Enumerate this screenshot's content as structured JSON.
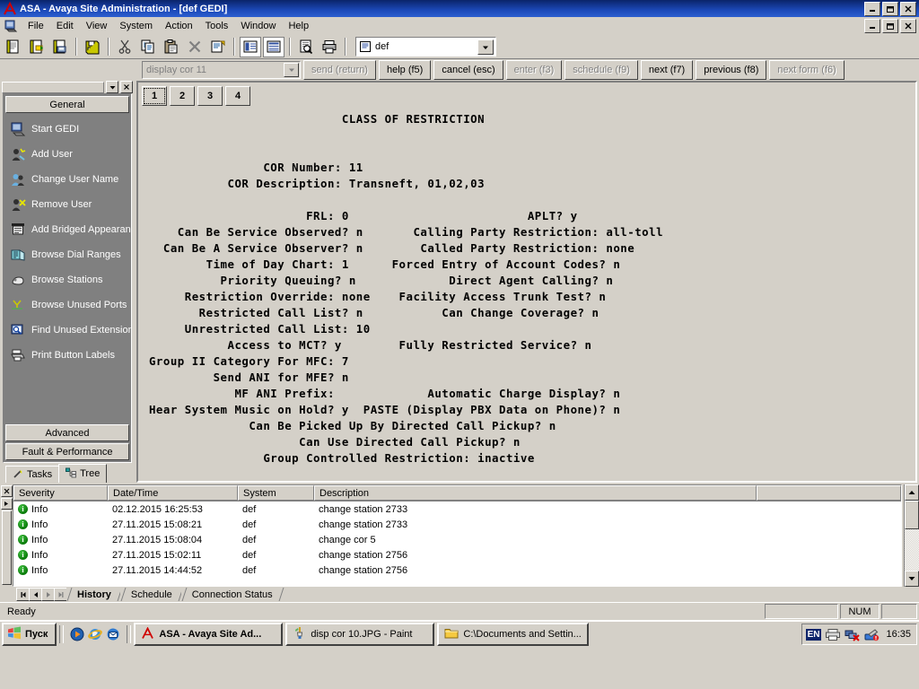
{
  "window": {
    "title": "ASA - Avaya Site Administration - [def GEDI]",
    "logo_icon": "avaya-a-icon",
    "controls": [
      "minimize",
      "restore",
      "close"
    ]
  },
  "menubar": {
    "doc_icon": "gedi-doc-icon",
    "items": [
      "File",
      "Edit",
      "View",
      "System",
      "Action",
      "Tools",
      "Window",
      "Help"
    ],
    "controls": [
      "minimize",
      "restore",
      "close"
    ]
  },
  "toolbar": {
    "buttons": [
      {
        "name": "new-icon"
      },
      {
        "name": "open-icon"
      },
      {
        "name": "save-as-icon"
      },
      {
        "name": "save-all-icon"
      },
      {
        "name": "cut-icon"
      },
      {
        "name": "copy-icon"
      },
      {
        "name": "paste-icon"
      },
      {
        "name": "delete-icon"
      },
      {
        "name": "properties-icon"
      },
      {
        "name": "list-view-icon"
      },
      {
        "name": "details-view-icon"
      },
      {
        "name": "print-preview-icon"
      },
      {
        "name": "print-icon"
      }
    ],
    "system_combo": {
      "icon": "system-icon",
      "value": "def",
      "arrow": "chevron-down-icon"
    }
  },
  "commandbar": {
    "command_input": {
      "value": "display cor 11",
      "arrow": "chevron-down-icon"
    },
    "buttons": [
      {
        "label": "send (return)",
        "disabled": true
      },
      {
        "label": "help (f5)",
        "disabled": false
      },
      {
        "label": "cancel (esc)",
        "disabled": false
      },
      {
        "label": "enter (f3)",
        "disabled": true
      },
      {
        "label": "schedule (f9)",
        "disabled": true
      },
      {
        "label": "next (f7)",
        "disabled": false
      },
      {
        "label": "previous (f8)",
        "disabled": false
      },
      {
        "label": "next form (f6)",
        "disabled": true
      }
    ]
  },
  "sidebar": {
    "collapse_arrow_icon": "chevron-down-icon",
    "close_icon": "close-icon",
    "group_header": "General",
    "items": [
      {
        "label": "Start GEDI",
        "icon": "start-gedi-icon"
      },
      {
        "label": "Add User",
        "icon": "add-user-icon"
      },
      {
        "label": "Change User Name",
        "icon": "change-user-icon"
      },
      {
        "label": "Remove User",
        "icon": "remove-user-icon"
      },
      {
        "label": "Add Bridged Appearan",
        "icon": "bridged-appearance-icon"
      },
      {
        "label": "Browse Dial Ranges",
        "icon": "dial-ranges-icon"
      },
      {
        "label": "Browse Stations",
        "icon": "stations-icon"
      },
      {
        "label": "Browse Unused Ports",
        "icon": "unused-ports-icon"
      },
      {
        "label": "Find Unused Extension",
        "icon": "find-extension-icon"
      },
      {
        "label": "Print Button Labels",
        "icon": "print-labels-icon"
      }
    ],
    "bottom_groups": [
      "Advanced",
      "Fault & Performance"
    ],
    "tabs": [
      {
        "label": "Tasks",
        "icon": "wand-icon",
        "selected": false
      },
      {
        "label": "Tree",
        "icon": "tree-icon",
        "selected": true
      }
    ]
  },
  "form": {
    "page_tabs": [
      "1",
      "2",
      "3",
      "4"
    ],
    "active_page": "1",
    "screen_lines": [
      "                            CLASS OF RESTRICTION",
      "",
      "",
      "                 COR Number: 11",
      "            COR Description: Transneft, 01,02,03",
      "",
      "                       FRL: 0                         APLT? y",
      "     Can Be Service Observed? n       Calling Party Restriction: all-toll",
      "   Can Be A Service Observer? n        Called Party Restriction: none",
      "         Time of Day Chart: 1      Forced Entry of Account Codes? n",
      "           Priority Queuing? n             Direct Agent Calling? n",
      "      Restriction Override: none    Facility Access Trunk Test? n",
      "        Restricted Call List? n           Can Change Coverage? n",
      "      Unrestricted Call List: 10",
      "            Access to MCT? y        Fully Restricted Service? n",
      " Group II Category For MFC: 7",
      "          Send ANI for MFE? n",
      "             MF ANI Prefix:             Automatic Charge Display? n",
      " Hear System Music on Hold? y  PASTE (Display PBX Data on Phone)? n",
      "               Can Be Picked Up By Directed Call Pickup? n",
      "                      Can Use Directed Call Pickup? n",
      "                 Group Controlled Restriction: inactive"
    ],
    "fields": {
      "title": "CLASS OF RESTRICTION",
      "cor_number": {
        "label": "COR Number:",
        "value": "11"
      },
      "cor_description": {
        "label": "COR Description:",
        "value": "Transneft, 01,02,03"
      },
      "frl": {
        "label": "FRL:",
        "value": "0"
      },
      "aplt": {
        "label": "APLT?",
        "value": "y"
      },
      "can_be_service_observed": {
        "label": "Can Be Service Observed?",
        "value": "n"
      },
      "calling_party_restriction": {
        "label": "Calling Party Restriction:",
        "value": "all-toll"
      },
      "can_be_a_service_observer": {
        "label": "Can Be A Service Observer?",
        "value": "n"
      },
      "called_party_restriction": {
        "label": "Called Party Restriction:",
        "value": "none"
      },
      "time_of_day_chart": {
        "label": "Time of Day Chart:",
        "value": "1"
      },
      "forced_entry_of_account_codes": {
        "label": "Forced Entry of Account Codes?",
        "value": "n"
      },
      "priority_queuing": {
        "label": "Priority Queuing?",
        "value": "n"
      },
      "direct_agent_calling": {
        "label": "Direct Agent Calling?",
        "value": "n"
      },
      "restriction_override": {
        "label": "Restriction Override:",
        "value": "none"
      },
      "facility_access_trunk_test": {
        "label": "Facility Access Trunk Test?",
        "value": "n"
      },
      "restricted_call_list": {
        "label": "Restricted Call List?",
        "value": "n"
      },
      "can_change_coverage": {
        "label": "Can Change Coverage?",
        "value": "n"
      },
      "unrestricted_call_list": {
        "label": "Unrestricted Call List:",
        "value": "10"
      },
      "access_to_mct": {
        "label": "Access to MCT?",
        "value": "y"
      },
      "fully_restricted_service": {
        "label": "Fully Restricted Service?",
        "value": "n"
      },
      "group_ii_category_for_mfc": {
        "label": "Group II Category For MFC:",
        "value": "7"
      },
      "send_ani_for_mfe": {
        "label": "Send ANI for MFE?",
        "value": "n"
      },
      "mf_ani_prefix": {
        "label": "MF ANI Prefix:",
        "value": ""
      },
      "automatic_charge_display": {
        "label": "Automatic Charge Display?",
        "value": "n"
      },
      "hear_system_music_on_hold": {
        "label": "Hear System Music on Hold?",
        "value": "y"
      },
      "paste": {
        "label": "PASTE (Display PBX Data on Phone)?",
        "value": "n"
      },
      "can_be_picked_up": {
        "label": "Can Be Picked Up By Directed Call Pickup?",
        "value": "n"
      },
      "can_use_directed_call_pickup": {
        "label": "Can Use Directed Call Pickup?",
        "value": "n"
      },
      "group_controlled_restriction": {
        "label": "Group Controlled Restriction:",
        "value": "inactive"
      }
    }
  },
  "log": {
    "close_icon": "close-icon",
    "expand_icon": "chevron-right-icon",
    "columns": [
      "Severity",
      "Date/Time",
      "System",
      "Description"
    ],
    "rows": [
      {
        "severity": "Info",
        "datetime": "02.12.2015 16:25:53",
        "system": "def",
        "description": "change station 2733"
      },
      {
        "severity": "Info",
        "datetime": "27.11.2015 15:08:21",
        "system": "def",
        "description": "change station 2733"
      },
      {
        "severity": "Info",
        "datetime": "27.11.2015 15:08:04",
        "system": "def",
        "description": "change cor 5"
      },
      {
        "severity": "Info",
        "datetime": "27.11.2015 15:02:11",
        "system": "def",
        "description": "change station 2756"
      },
      {
        "severity": "Info",
        "datetime": "27.11.2015 14:44:52",
        "system": "def",
        "description": "change station 2756"
      }
    ],
    "scroll_up_icon": "scroll-up-icon",
    "scroll_down_icon": "scroll-down-icon"
  },
  "bottom_tabs": {
    "nav": [
      "first",
      "previous",
      "next",
      "last"
    ],
    "tabs": [
      {
        "label": "History",
        "selected": true
      },
      {
        "label": "Schedule",
        "selected": false
      },
      {
        "label": "Connection Status",
        "selected": false
      }
    ]
  },
  "statusbar": {
    "text": "Ready",
    "panes": [
      "",
      "NUM",
      ""
    ]
  },
  "taskbar": {
    "start_label": "Пуск",
    "start_icon": "windows-flag-icon",
    "quicklaunch": [
      {
        "icon": "media-player-icon"
      },
      {
        "icon": "internet-explorer-icon"
      },
      {
        "icon": "outlook-express-icon"
      }
    ],
    "tasks": [
      {
        "label": "ASA - Avaya Site Ad...",
        "icon": "avaya-a-icon",
        "active": true
      },
      {
        "label": "disp cor 10.JPG - Paint",
        "icon": "paint-icon",
        "active": false
      },
      {
        "label": "C:\\Documents and Settin...",
        "icon": "folder-icon",
        "active": false
      }
    ],
    "tray": {
      "language": "EN",
      "icons": [
        "printer-icon",
        "network-disconnected-icon",
        "safely-remove-icon"
      ],
      "clock": "16:35"
    }
  },
  "colors": {
    "titlebar_start": "#0a246a",
    "titlebar_end": "#2c5fd0",
    "face": "#d4d0c8",
    "sidebar": "#808080",
    "terminal_bg": "#d4d0c8",
    "terminal_fg": "#000000",
    "info_green": "#0a7a0a"
  }
}
